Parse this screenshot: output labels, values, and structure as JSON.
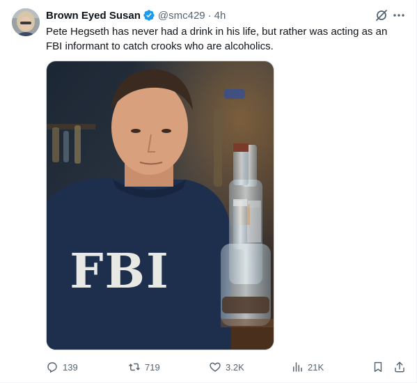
{
  "tweet": {
    "author_name": "Brown Eyed Susan",
    "handle": "@smc429",
    "separator": "·",
    "time": "4h",
    "text": "Pete Hegseth has never had a drink in his life, but rather was acting as an FBI informant to catch crooks who are alcoholics.",
    "media": {
      "sweater_text": "FBI"
    }
  },
  "actions": {
    "replies": "139",
    "reposts": "719",
    "likes": "3.2K",
    "views": "21K"
  },
  "icons": {
    "verified": "verified-badge-icon",
    "grok": "grok-icon",
    "more": "more-icon",
    "reply": "reply-icon",
    "repost": "repost-icon",
    "like": "heart-icon",
    "views": "views-icon",
    "bookmark": "bookmark-icon",
    "share": "share-icon"
  },
  "colors": {
    "text": "#0f1419",
    "secondary": "#536471",
    "verified": "#1d9bf0"
  }
}
